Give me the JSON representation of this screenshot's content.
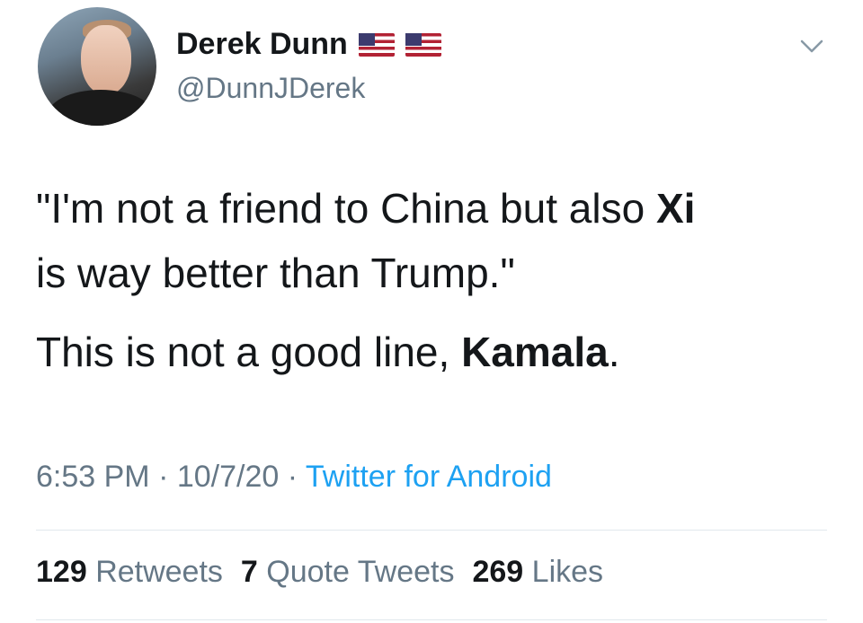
{
  "author": {
    "display_name": "Derek Dunn",
    "handle": "@DunnJDerek",
    "badges": [
      "us-flag-icon",
      "us-flag-icon"
    ]
  },
  "tweet": {
    "quote_line": "\"I'm not a friend to China but also ",
    "quote_bold": "Xi",
    "quote_line2": "is way better than Trump.\"",
    "comment_prefix": "This is not a good line, ",
    "comment_bold": "Kamala",
    "comment_suffix": "."
  },
  "meta": {
    "time": "6:53 PM",
    "sep1": " · ",
    "date": "10/7/20",
    "sep2": " · ",
    "source": "Twitter for Android"
  },
  "stats": {
    "retweets_count": "129",
    "retweets_label": "Retweets",
    "quotes_count": "7",
    "quotes_label": "Quote Tweets",
    "likes_count": "269",
    "likes_label": "Likes"
  }
}
